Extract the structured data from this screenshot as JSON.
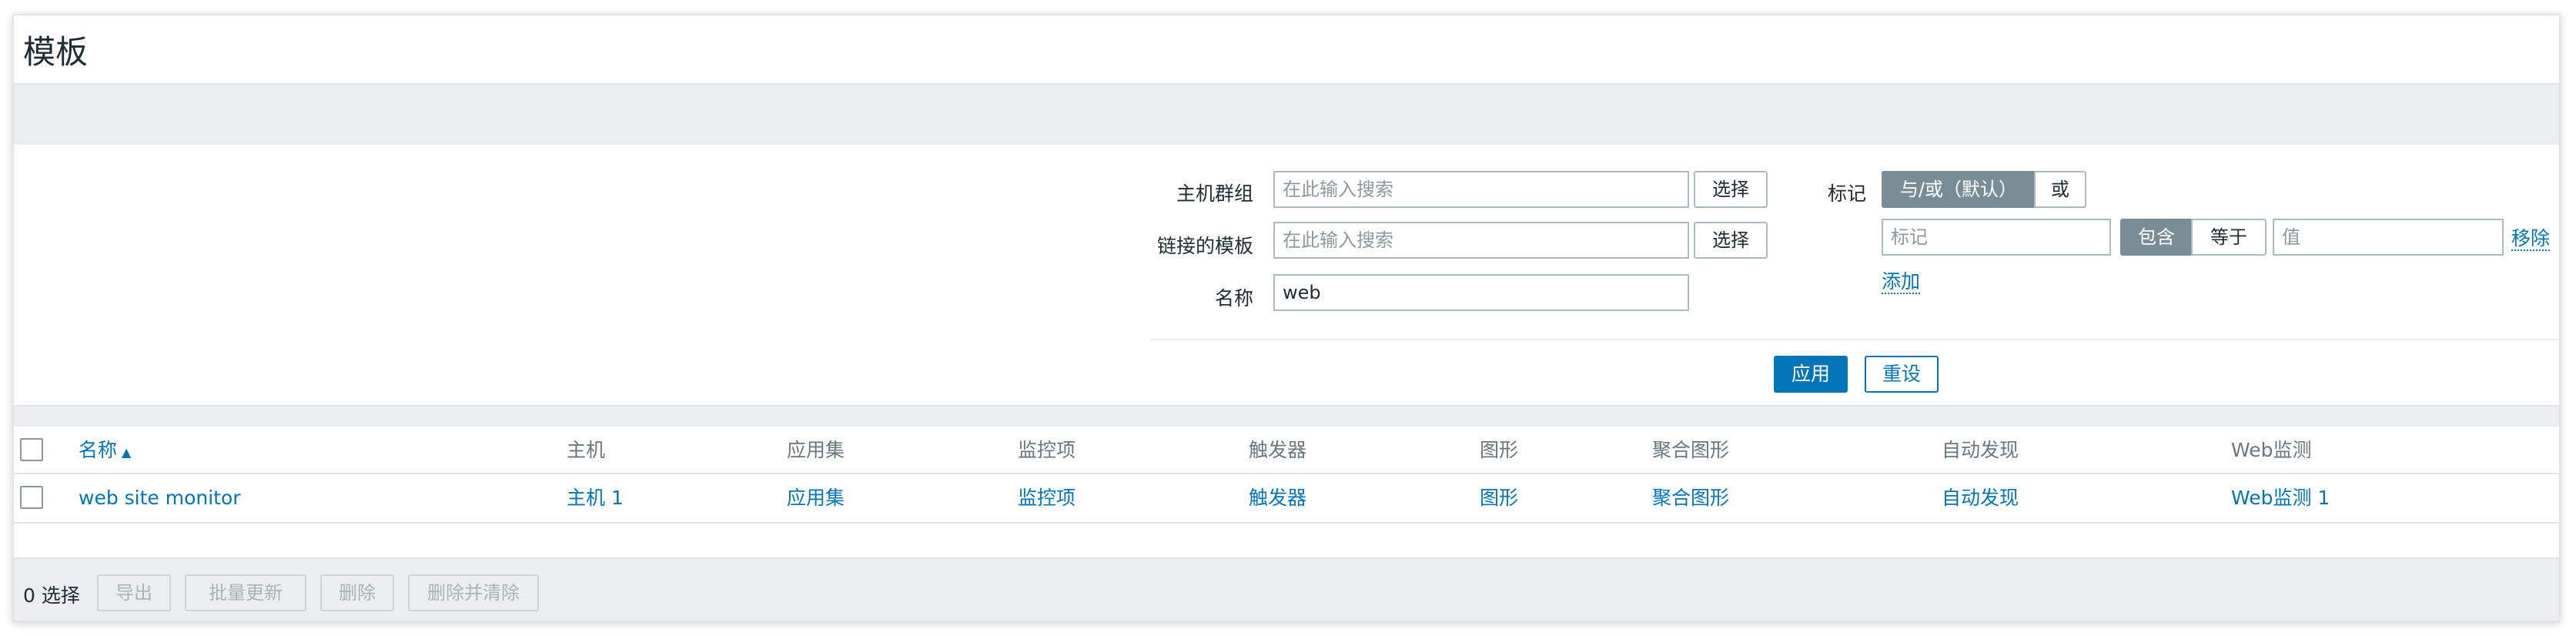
{
  "page": {
    "title": "模板"
  },
  "filter": {
    "host_groups": {
      "label": "主机群组",
      "placeholder": "在此输入搜索",
      "select_label": "选择"
    },
    "linked_templates": {
      "label": "链接的模板",
      "placeholder": "在此输入搜索",
      "select_label": "选择"
    },
    "name": {
      "label": "名称",
      "value": "web"
    },
    "tags": {
      "label": "标记",
      "evaltype": [
        {
          "label": "与/或（默认）",
          "selected": true
        },
        {
          "label": "或",
          "selected": false
        }
      ],
      "tag_placeholder": "标记",
      "operator": [
        {
          "label": "包含",
          "selected": true
        },
        {
          "label": "等于",
          "selected": false
        }
      ],
      "value_placeholder": "值",
      "remove_label": "移除",
      "add_label": "添加"
    },
    "apply_label": "应用",
    "reset_label": "重设"
  },
  "table": {
    "columns": [
      "名称",
      "主机",
      "应用集",
      "监控项",
      "触发器",
      "图形",
      "聚合图形",
      "自动发现",
      "Web监测"
    ],
    "sort_indicator": "▲",
    "rows": [
      {
        "name": "web site monitor",
        "hosts": "主机 1",
        "applications": "应用集",
        "items": "监控项",
        "triggers": "触发器",
        "graphs": "图形",
        "screens": "聚合图形",
        "discovery": "自动发现",
        "web": "Web监测 1"
      }
    ]
  },
  "footer": {
    "selected_count": "0 选择",
    "actions": [
      "导出",
      "批量更新",
      "删除",
      "删除并清除"
    ]
  },
  "colors": {
    "accent": "#0275b8",
    "segment_active": "#7a8c95",
    "panel_bg": "#ebeef0"
  }
}
